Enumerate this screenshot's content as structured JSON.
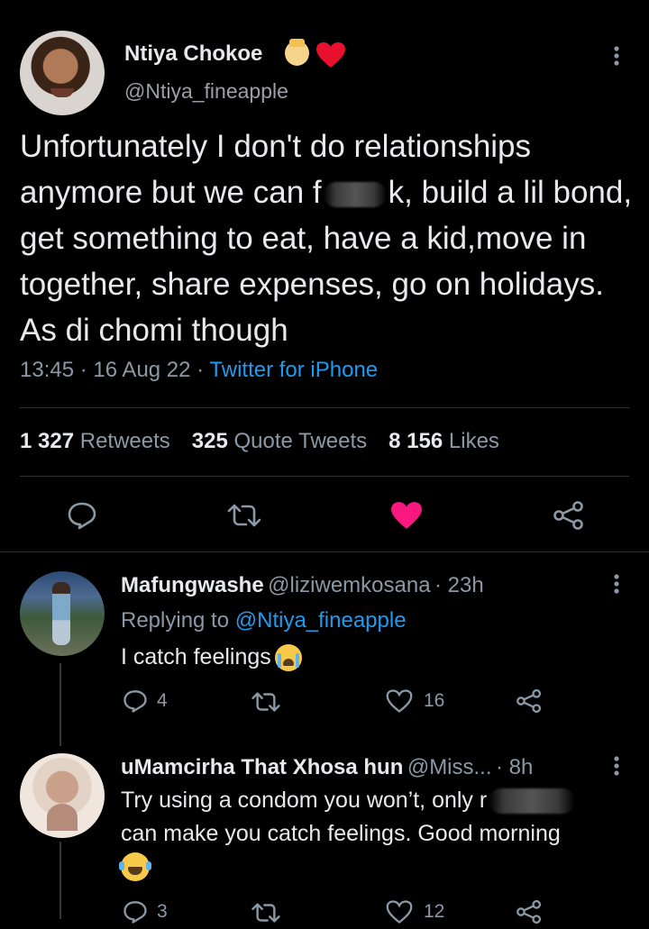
{
  "main_tweet": {
    "display_name": "Ntiya Chokoe",
    "handle": "@Ntiya_fineapple",
    "text_part1": "Unfortunately I don't do relationships anymore but we can f",
    "text_part2": "k, build a lil bond, get something to eat, have a kid,move in together, share expenses, go on holidays. As di chomi though",
    "time": "13:45",
    "dot1": " · ",
    "date": "16 Aug 22",
    "dot2": " · ",
    "source": "Twitter for iPhone",
    "stats": {
      "retweets_count": "1 327",
      "retweets_label": "Retweets",
      "quotes_count": "325",
      "quotes_label": "Quote Tweets",
      "likes_count": "8 156",
      "likes_label": "Likes"
    },
    "liked": true
  },
  "replies": [
    {
      "display_name": "Mafungwashe",
      "handle": "@liziwemkosana",
      "time": "· 23h",
      "replying_label": "Replying to",
      "replying_handle": "@Ntiya_fineapple",
      "text": "I catch feelings",
      "reply_count": "4",
      "like_count": "16"
    },
    {
      "display_name": "uMamcirha That Xhosa hun",
      "handle": "@Miss...",
      "time": "· 8h",
      "text_line1": "Try using a condom you won’t, only r",
      "text_line2": "can make you catch feelings. Good morning",
      "reply_count": "3",
      "like_count": "12"
    }
  ],
  "colors": {
    "background": "#000000",
    "text": "#e7e9ea",
    "secondary": "#8b98a5",
    "link": "#1d9bf0",
    "like": "#f91880",
    "divider": "#2f3336"
  },
  "icons": {
    "princess": "princess-emoji-icon",
    "heart": "red-heart-icon",
    "more": "more-dots-icon",
    "reply": "reply-bubble-icon",
    "retweet": "retweet-icon",
    "like": "like-heart-icon",
    "share": "share-icon",
    "crying": "crying-emoji-icon",
    "laughing": "laughing-emoji-icon"
  }
}
